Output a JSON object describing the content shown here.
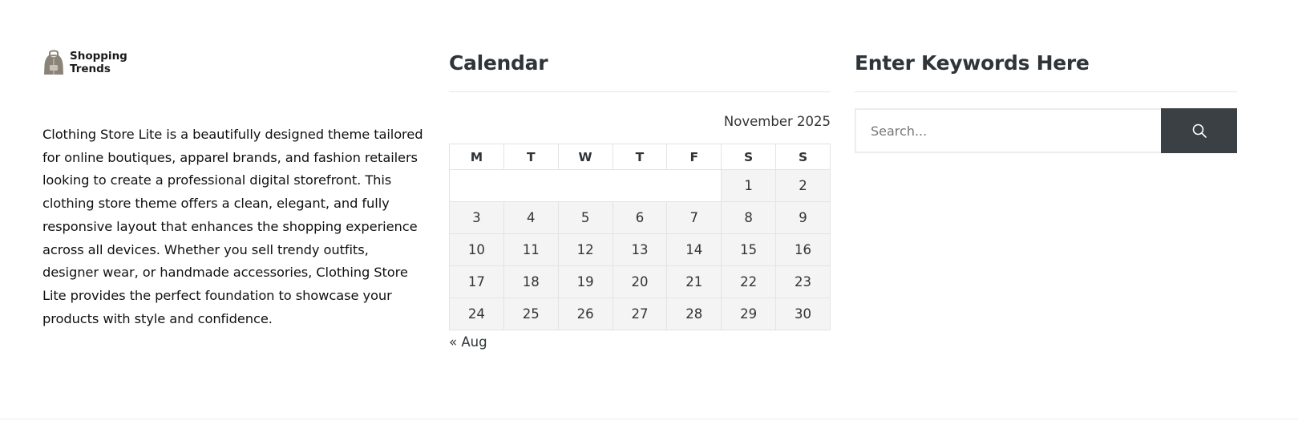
{
  "brand": {
    "name_line1": "Shopping",
    "name_line2": "Trends"
  },
  "about": {
    "text": "Clothing Store Lite is a beautifully designed theme tailored for online boutiques, apparel brands, and fashion retailers looking to create a professional digital storefront. This clothing store theme offers a clean, elegant, and fully responsive layout that enhances the shopping experience across all devices. Whether you sell trendy outfits, designer wear, or handmade accessories, Clothing Store Lite provides the perfect foundation to showcase your products with style and confidence."
  },
  "calendar": {
    "title": "Calendar",
    "caption": "November 2025",
    "weekdays": [
      "M",
      "T",
      "W",
      "T",
      "F",
      "S",
      "S"
    ],
    "weeks": [
      [
        "",
        "",
        "",
        "",
        "",
        "1",
        "2"
      ],
      [
        "3",
        "4",
        "5",
        "6",
        "7",
        "8",
        "9"
      ],
      [
        "10",
        "11",
        "12",
        "13",
        "14",
        "15",
        "16"
      ],
      [
        "17",
        "18",
        "19",
        "20",
        "21",
        "22",
        "23"
      ],
      [
        "24",
        "25",
        "26",
        "27",
        "28",
        "29",
        "30"
      ]
    ],
    "prev_link": "« Aug"
  },
  "search": {
    "title": "Enter Keywords Here",
    "placeholder": "Search...",
    "button_icon": "search-icon"
  },
  "colors": {
    "heading": "#2f3438",
    "button_bg": "#3a4043",
    "cell_bg": "#f4f4f4",
    "border": "#e3e3e3"
  }
}
